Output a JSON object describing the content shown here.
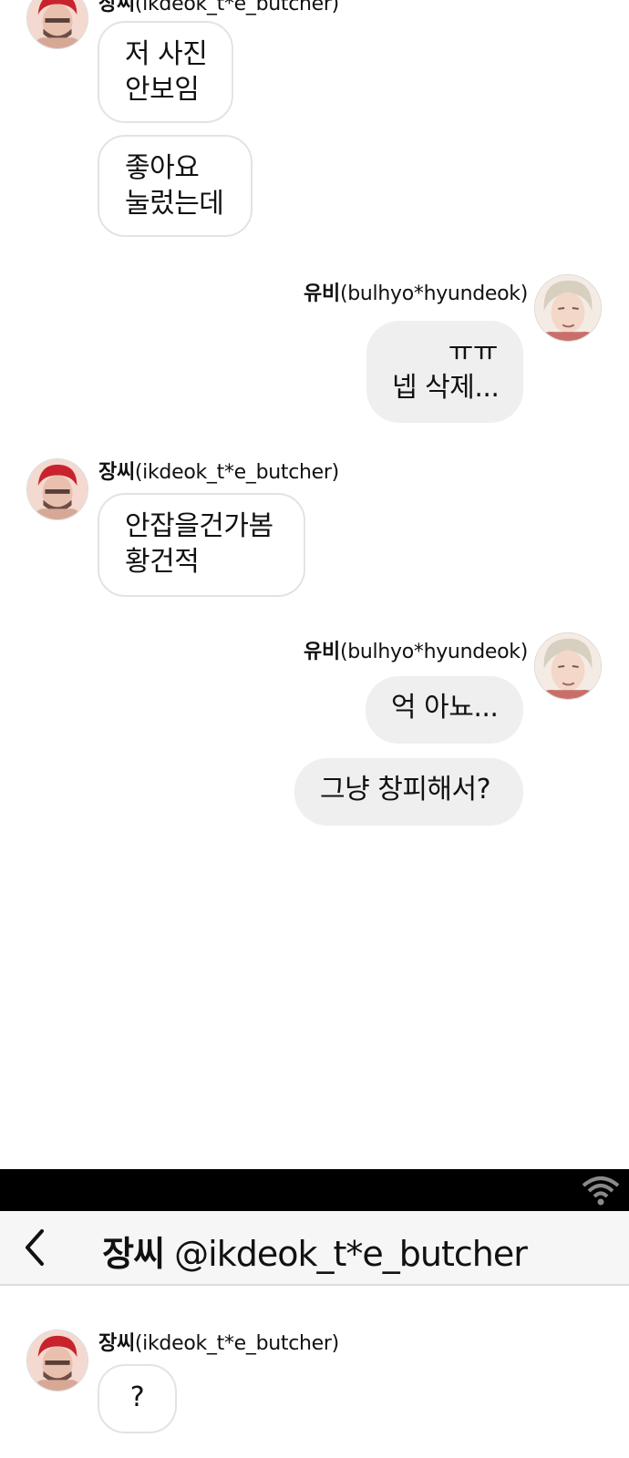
{
  "contacts": {
    "jang": {
      "name": "장씨",
      "handle": "(ikdeok_t*e_butcher)"
    },
    "yubi": {
      "name": "유비",
      "handle": "(bulhyo*hyundeok)"
    }
  },
  "messages": {
    "m1": {
      "line1": "저 사진",
      "line2": "안보임"
    },
    "m2": {
      "line1": "좋아요",
      "line2": "눌렀는데"
    },
    "m3": {
      "line1": "ㅠㅠ",
      "line2": "넵 삭제..."
    },
    "m4": {
      "line1": "안잡을건가봄",
      "line2": "황건적"
    },
    "m5": {
      "text": "억 아뇨..."
    },
    "m6": {
      "text": "그냥 창피해서?"
    }
  },
  "chat_header": {
    "name": "장씨",
    "handle": "@ikdeok_t*e_butcher"
  },
  "new_thread": {
    "sender_name": "장씨",
    "sender_handle": "(ikdeok_t*e_butcher)",
    "message": "?"
  },
  "colors": {
    "incoming_bubble_border": "#e3e3e3",
    "outgoing_bubble_bg": "#efefef",
    "status_bar_bg": "#000000",
    "nav_bar_bg": "#f6f6f6"
  }
}
